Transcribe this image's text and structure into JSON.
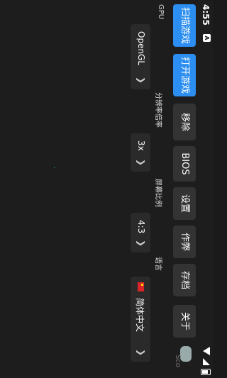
{
  "status": {
    "time": "4:55",
    "notif": "A"
  },
  "buttons": {
    "scan": "扫描游戏",
    "open": "打开游戏",
    "remove": "移除",
    "bios": "BIOS",
    "settings": "设置",
    "cheat": "作弊",
    "saves": "存档",
    "about": "关于"
  },
  "options": {
    "gpu_label": "GPU",
    "gpu_value": "OpenGL",
    "resolution_label": "分辨率倍率",
    "resolution_value": "3x",
    "aspect_label": "屏幕比例",
    "aspect_value": "4:3",
    "language_label": "语言",
    "language_value": "简体中文"
  },
  "footer": {
    "brand_text": "Sco"
  },
  "colors": {
    "accent": "#2b8ef0",
    "background": "#1d1d1d",
    "button_dark": "#333333"
  }
}
